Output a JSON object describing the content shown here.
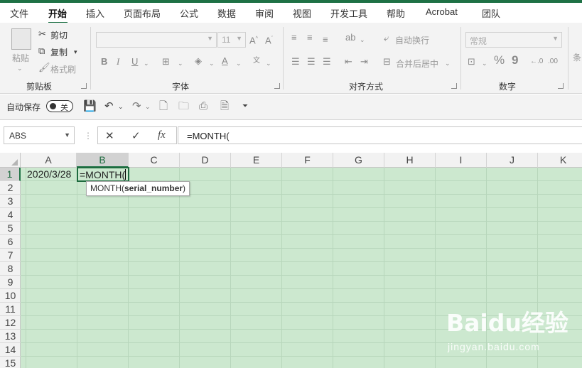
{
  "tabs": [
    "文件",
    "开始",
    "插入",
    "页面布局",
    "公式",
    "数据",
    "审阅",
    "视图",
    "开发工具",
    "帮助",
    "Acrobat",
    "团队"
  ],
  "ribbon": {
    "clipboard": {
      "paste": "粘贴",
      "cut": "剪切",
      "copy": "复制",
      "format_painter": "格式刷",
      "label": "剪贴板"
    },
    "font": {
      "size": "11",
      "label": "字体",
      "bold": "B",
      "italic": "I",
      "underline": "U"
    },
    "alignment": {
      "wrap": "自动换行",
      "merge": "合并后居中",
      "label": "对齐方式"
    },
    "number": {
      "format": "常规",
      "percent": "%",
      "comma": "9",
      "label": "数字"
    },
    "more": "条"
  },
  "qat": {
    "autosave_label": "自动保存",
    "autosave_state": "关"
  },
  "formula_bar": {
    "name_box": "ABS",
    "cancel": "✕",
    "enter": "✓",
    "fx": "fx",
    "content": "=MONTH("
  },
  "columns": [
    "A",
    "B",
    "C",
    "D",
    "E",
    "F",
    "G",
    "H",
    "I",
    "J",
    "K"
  ],
  "rows": [
    "1",
    "2",
    "3",
    "4",
    "5",
    "6",
    "7",
    "8",
    "9",
    "10",
    "11",
    "12",
    "13",
    "14",
    "15"
  ],
  "cells": {
    "A1": "2020/3/28",
    "B1": "=MONTH("
  },
  "tooltip": {
    "func": "MONTH(",
    "arg": "serial_number",
    "close": ")"
  },
  "watermark": {
    "logo": "Baidu经验",
    "url": "jingyan.baidu.com"
  },
  "colors": {
    "accent": "#1e7145",
    "cell_bg": "#cce8cf",
    "selection": "#217346"
  }
}
